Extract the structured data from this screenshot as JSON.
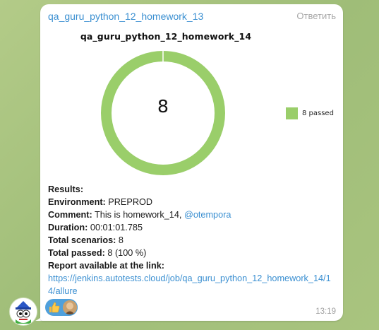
{
  "message": {
    "sender": "qa_guru_python_12_homework_13",
    "reply_label": "Ответить",
    "time": "13:19"
  },
  "chart_data": {
    "type": "pie",
    "title": "qa_guru_python_12_homework_14",
    "center_label": "8",
    "slices": [
      {
        "label": "8 passed",
        "value": 8,
        "color": "#9ace6a"
      }
    ],
    "legend_position": "right"
  },
  "report": {
    "results_label": "Results:",
    "environment_label": "Environment:",
    "environment_value": " PREPROD",
    "comment_label": "Comment:",
    "comment_value": " This is homework_14, ",
    "comment_mention": "@otempora",
    "duration_label": "Duration:",
    "duration_value": " 00:01:01.785",
    "total_scenarios_label": "Total scenarios:",
    "total_scenarios_value": " 8",
    "total_passed_label": "Total passed:",
    "total_passed_value": " 8 (100 %)",
    "report_link_label": "Report available at the link:",
    "report_url": "https://jenkins.autotests.cloud/job/qa_guru_python_12_homework_14/14/allure"
  },
  "reactions": {
    "emoji": "thumbs-up-icon",
    "color": "#4fa0db"
  }
}
